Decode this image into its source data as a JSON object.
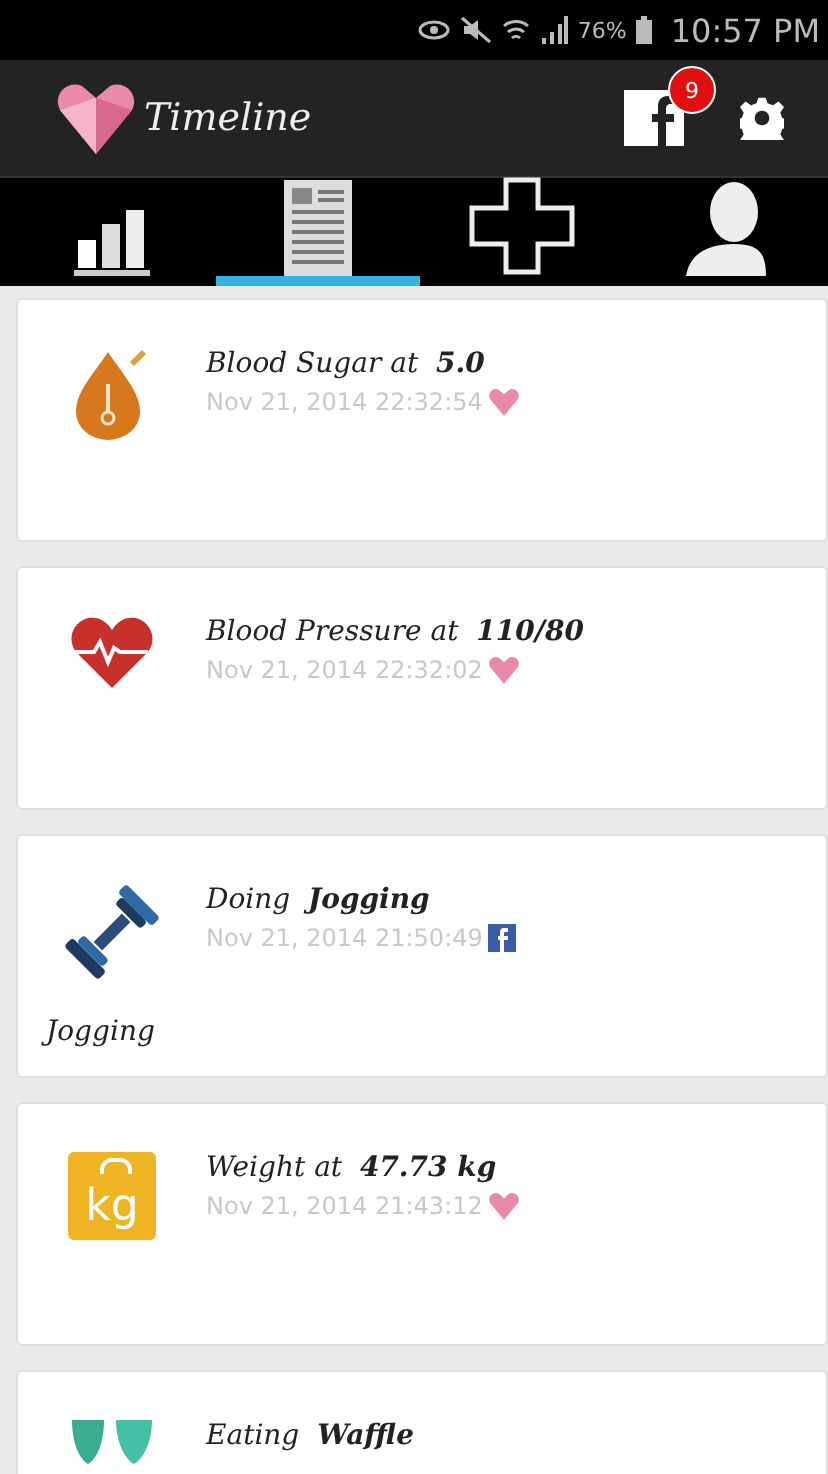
{
  "status_bar": {
    "battery": "76%",
    "time": "10:57 PM"
  },
  "toolbar": {
    "title": "Timeline",
    "notification_count": "9"
  },
  "tabs": [
    {
      "kind": "stats",
      "selected": false
    },
    {
      "kind": "list",
      "selected": true
    },
    {
      "kind": "health",
      "selected": false
    },
    {
      "kind": "profile",
      "selected": false
    }
  ],
  "entries": [
    {
      "kind": "sugar",
      "title": "Blood Sugar at  **5.0**",
      "timestamp": "Nov 21, 2014 22:32:54",
      "source": {
        "kind": "app"
      }
    },
    {
      "kind": "pressure",
      "title": "Blood Pressure at  **110/80**",
      "timestamp": "Nov 21, 2014 22:32:02",
      "source": {
        "kind": "app"
      }
    },
    {
      "kind": "exercise",
      "title": "Doing  **Jogging**",
      "timestamp": "Nov 21, 2014 21:50:49",
      "source": {
        "kind": "facebook"
      },
      "caption": "Jogging"
    },
    {
      "kind": "weight",
      "icon_text": "kg",
      "title": "Weight at  **47.73 kg**",
      "timestamp": "Nov 21, 2014 21:43:12",
      "source": {
        "kind": "app"
      }
    },
    {
      "kind": "food",
      "title": "Eating  **Waffle**"
    }
  ]
}
